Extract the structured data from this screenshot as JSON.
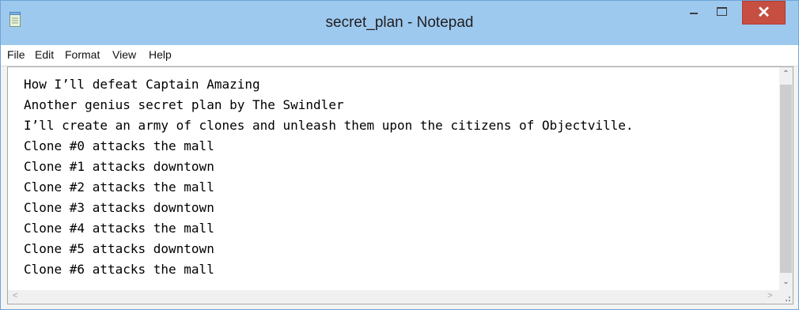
{
  "window": {
    "title": "secret_plan - Notepad"
  },
  "controls": {
    "close_glyph": "✕"
  },
  "menu": [
    {
      "label": "File"
    },
    {
      "label": "Edit"
    },
    {
      "label": "Format"
    },
    {
      "label": "View"
    },
    {
      "label": "Help"
    }
  ],
  "document": {
    "lines": [
      "How I’ll defeat Captain Amazing",
      "Another genius secret plan by The Swindler",
      "I’ll create an army of clones and unleash them upon the citizens of Objectville.",
      "Clone #0 attacks the mall",
      "Clone #1 attacks downtown",
      "Clone #2 attacks the mall",
      "Clone #3 attacks downtown",
      "Clone #4 attacks the mall",
      "Clone #5 attacks downtown",
      "Clone #6 attacks the mall"
    ]
  },
  "icons": {
    "app": "notepad-icon",
    "minimize": "minimize-icon",
    "maximize": "maximize-icon",
    "close": "close-icon"
  },
  "colors": {
    "titlebar": "#9ec9ef",
    "close_button": "#c64f42"
  }
}
